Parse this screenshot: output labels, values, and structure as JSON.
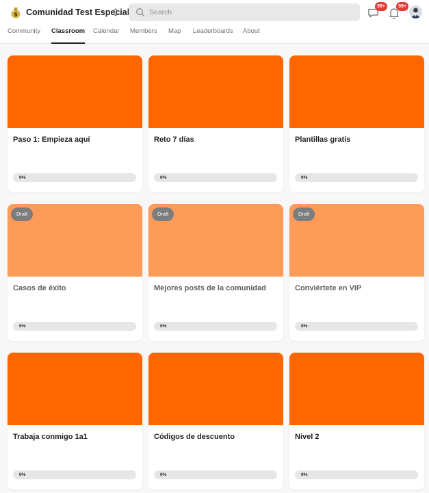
{
  "header": {
    "community_name": "Comunidad Test Especial",
    "logo_icon": "money-bag-icon",
    "switcher_icon": "chevron-up-down-icon",
    "search": {
      "placeholder": "Search",
      "value": ""
    },
    "chat": {
      "icon": "chat-icon",
      "badge": "99+"
    },
    "notifications": {
      "icon": "bell-icon",
      "badge": "99+"
    },
    "avatar_icon": "user-avatar"
  },
  "nav": {
    "tabs": [
      {
        "label": "Community",
        "active": false
      },
      {
        "label": "Classroom",
        "active": true
      },
      {
        "label": "Calendar",
        "active": false
      },
      {
        "label": "Members",
        "active": false
      },
      {
        "label": "Map",
        "active": false
      },
      {
        "label": "Leaderboards",
        "active": false
      },
      {
        "label": "About",
        "active": false
      }
    ]
  },
  "courses": [
    {
      "title": "Paso 1: Empieza aquí",
      "progress_label": "0%",
      "progress": 0,
      "draft": false
    },
    {
      "title": "Reto 7 días",
      "progress_label": "0%",
      "progress": 0,
      "draft": false
    },
    {
      "title": "Plantillas gratis",
      "progress_label": "0%",
      "progress": 0,
      "draft": false
    },
    {
      "title": "Casos de éxito",
      "progress_label": "0%",
      "progress": 0,
      "draft": true,
      "draft_label": "Draft"
    },
    {
      "title": "Mejores posts de la comunidad",
      "progress_label": "0%",
      "progress": 0,
      "draft": true,
      "draft_label": "Draft"
    },
    {
      "title": "Conviértete en VIP",
      "progress_label": "0%",
      "progress": 0,
      "draft": true,
      "draft_label": "Draft"
    },
    {
      "title": "Trabaja conmigo 1a1",
      "progress_label": "0%",
      "progress": 0,
      "draft": false
    },
    {
      "title": "Códigos de descuento",
      "progress_label": "0%",
      "progress": 0,
      "draft": false
    },
    {
      "title": "Nivel 2",
      "progress_label": "0%",
      "progress": 0,
      "draft": false
    }
  ],
  "colors": {
    "accent": "#ff6600",
    "badge": "#e53935",
    "draft_chip": "#7d7d7d",
    "page_background": "#f7f7f7"
  }
}
